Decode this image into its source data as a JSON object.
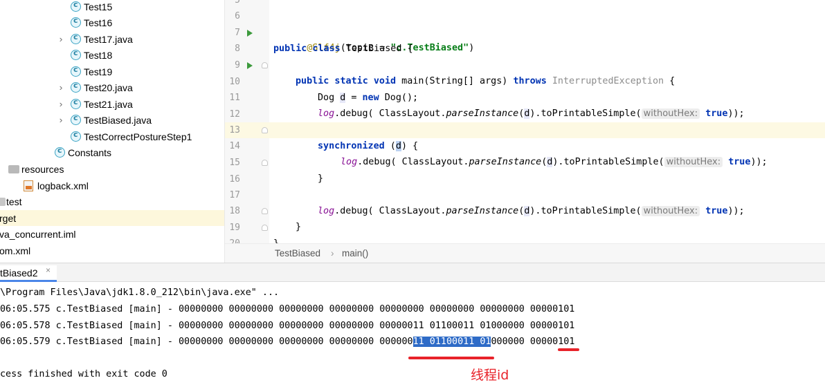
{
  "tree": {
    "items": [
      {
        "label": "Test15",
        "icon": "java-class-icon",
        "expandable": false
      },
      {
        "label": "Test16",
        "icon": "java-class-icon",
        "expandable": false
      },
      {
        "label": "Test17.java",
        "icon": "java-class-icon",
        "expandable": true
      },
      {
        "label": "Test18",
        "icon": "java-class-icon",
        "expandable": false
      },
      {
        "label": "Test19",
        "icon": "java-class-icon",
        "expandable": false
      },
      {
        "label": "Test20.java",
        "icon": "java-class-icon",
        "expandable": true
      },
      {
        "label": "Test21.java",
        "icon": "java-class-icon",
        "expandable": true
      },
      {
        "label": "TestBiased.java",
        "icon": "java-class-icon",
        "expandable": true
      },
      {
        "label": "TestCorrectPostureStep1",
        "icon": "java-class-icon",
        "expandable": false
      },
      {
        "label": "Constants",
        "icon": "java-class-icon",
        "expandable": false
      },
      {
        "label": "resources",
        "icon": "folder-icon",
        "expandable": false
      },
      {
        "label": "logback.xml",
        "icon": "xml-file-icon",
        "expandable": false
      },
      {
        "label": "test",
        "icon": "folder-icon",
        "expandable": false
      },
      {
        "label": "rget",
        "icon": "folder-icon",
        "expandable": false
      },
      {
        "label": "va_concurrent.iml",
        "icon": "iml-file-icon",
        "expandable": false
      },
      {
        "label": "om.xml",
        "icon": "xml-file-icon",
        "expandable": false
      }
    ]
  },
  "editor": {
    "line_numbers": [
      "5",
      "6",
      "7",
      "8",
      "9",
      "10",
      "11",
      "12",
      "13",
      "14",
      "15",
      "16",
      "17",
      "18",
      "19",
      "20"
    ],
    "line6": {
      "annotation": "@Slf4j",
      "open": "(topic = ",
      "topic": "\"c.TestBiased\"",
      "close": ")"
    },
    "line7": {
      "kw": "public class",
      "rest": " TestBiased {"
    },
    "line9": {
      "kw": "public static void",
      "rest": " main(String[] args) ",
      "throws": "throws",
      "exc": " InterruptedException",
      "brace": " {"
    },
    "line10": {
      "type": "Dog ",
      "var": "d",
      "eq": " = ",
      "kw": "new",
      "rest": " Dog();"
    },
    "log_call": {
      "log": "log",
      "debug": ".debug( ClassLayout.",
      "method": "parseInstance",
      "open": "(",
      "var": "d",
      "mid": ").toPrintableSimple(",
      "hint": "withoutHex:",
      "kwtrue": "true",
      "end": "));"
    },
    "line13": {
      "kw": "synchronized",
      "open": " (",
      "var": "d",
      "close": ") {"
    },
    "close_brace": "}"
  },
  "breadcrumb": {
    "class": "TestBiased",
    "separator": "›",
    "method": "main()"
  },
  "run": {
    "tab_label": "tBiased2",
    "tab_close": "×",
    "cmd": "\\Program Files\\Java\\jdk1.8.0_212\\bin\\java.exe\" ...",
    "out1": "06:05.575 c.TestBiased [main] - 00000000 00000000 00000000 00000000 00000000 00000000 00000000 00000101",
    "out2": "06:05.578 c.TestBiased [main] - 00000000 00000000 00000000 00000000 00000011 01100011 01000000 00000101",
    "out3_pre": "06:05.579 c.TestBiased [main] - 00000000 00000000 00000000 00000000 000000",
    "out3_hl": "11 01100011 01",
    "out3_post": "000000 00000101",
    "finish": "cess finished with exit code 0",
    "annotation": "线程id"
  },
  "colors": {
    "keyword": "#0033b3",
    "string": "#067d17",
    "annotation": "#9e880d",
    "red_mark": "#e8232a",
    "selection": "#2e6bc7"
  }
}
